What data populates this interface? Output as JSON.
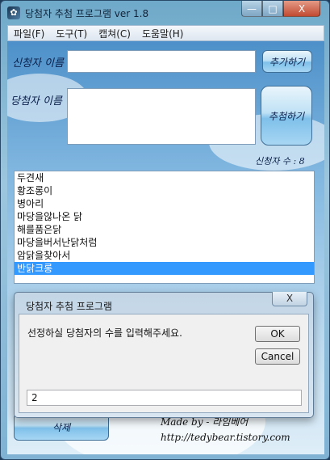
{
  "window": {
    "title": "당첨자 추첨 프로그램 ver 1.8",
    "close_symbol": "X"
  },
  "menu": [
    {
      "label": "파일(F)"
    },
    {
      "label": "도구(T)"
    },
    {
      "label": "캡쳐(C)"
    },
    {
      "label": "도움말(H)"
    }
  ],
  "form": {
    "applicant_label": "신청자 이름",
    "winner_label": "당첨자 이름",
    "add_button": "추가하기",
    "draw_button": "추첨하기",
    "applicant_count": "신청자 수 : 8"
  },
  "applicants": [
    {
      "name": "두견새",
      "selected": false
    },
    {
      "name": "황조롱이",
      "selected": false
    },
    {
      "name": "병아리",
      "selected": false
    },
    {
      "name": "마당을않나온 닭",
      "selected": false
    },
    {
      "name": "해를품은닭",
      "selected": false
    },
    {
      "name": "마당을버서난닭처럼",
      "selected": false
    },
    {
      "name": "암닭을찾아서",
      "selected": false
    },
    {
      "name": "반닭크롱",
      "selected": true
    }
  ],
  "footer": {
    "delete_button": "삭제",
    "made_by": "Made by - 라임베어",
    "url": "http://tedybear.tistory.com"
  },
  "dialog": {
    "title": "당첨자 추첨 프로그램",
    "close_symbol": "X",
    "message": "선정하실 당첨자의 수를 입력해주세요.",
    "ok": "OK",
    "cancel": "Cancel",
    "input_value": "2"
  }
}
